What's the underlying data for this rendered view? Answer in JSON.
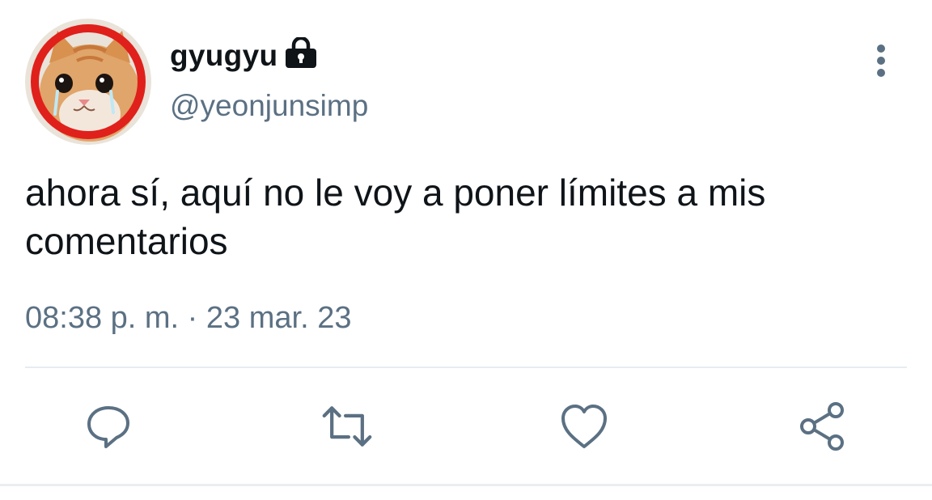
{
  "user": {
    "display_name": "gyugyu",
    "handle": "@yeonjunsimp",
    "protected_icon": "lock-icon",
    "avatar": "crying-cat-avatar"
  },
  "tweet": {
    "text": "ahora sí, aquí no le voy a poner límites a mis comentarios",
    "time": "08:38 p. m.",
    "separator": " · ",
    "date": "23 mar. 23"
  },
  "actions": [
    {
      "name": "reply",
      "icon": "comment-icon"
    },
    {
      "name": "retweet",
      "icon": "retweet-icon"
    },
    {
      "name": "like",
      "icon": "heart-icon"
    },
    {
      "name": "share",
      "icon": "share-icon"
    }
  ],
  "menu_icon": "more-vertical-icon",
  "colors": {
    "text_primary": "#0f1419",
    "text_secondary": "#5b7083",
    "icon": "#5b7083",
    "divider": "#e6ecf0",
    "avatar_ring": "#e0201b"
  }
}
